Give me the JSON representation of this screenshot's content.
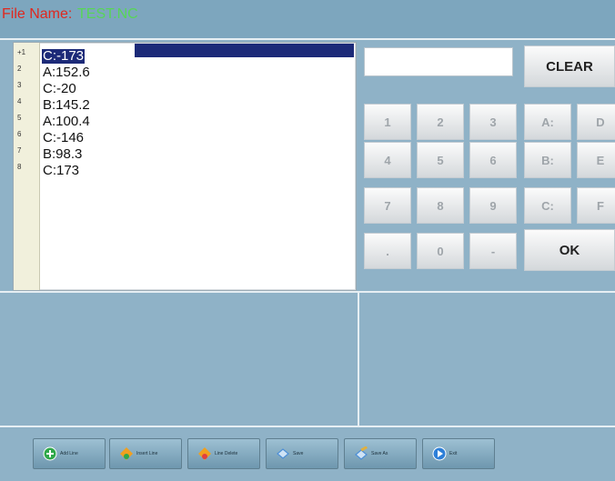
{
  "header": {
    "file_label": "File Name:",
    "file_value": "TEST.NC"
  },
  "editor": {
    "lines": [
      {
        "num": "+1",
        "text": "C:-173"
      },
      {
        "num": "2",
        "text": "A:152.6"
      },
      {
        "num": "3",
        "text": "C:-20"
      },
      {
        "num": "4",
        "text": "B:145.2"
      },
      {
        "num": "5",
        "text": "A:100.4"
      },
      {
        "num": "6",
        "text": "C:-146"
      },
      {
        "num": "7",
        "text": "B:98.3"
      },
      {
        "num": "8",
        "text": "C:173"
      }
    ],
    "selected_line": 1
  },
  "keypad": {
    "display_value": "",
    "clear_label": "CLEAR",
    "ok_label": "OK",
    "rows": [
      [
        "1",
        "2",
        "3",
        "A:",
        "D"
      ],
      [
        "4",
        "5",
        "6",
        "B:",
        "E"
      ],
      [
        "7",
        "8",
        "9",
        "C:",
        "F"
      ],
      [
        ".",
        "0",
        "-"
      ]
    ]
  },
  "toolbar": {
    "buttons": [
      {
        "label": "Add Line",
        "icon": "plus-circle-icon",
        "color": "#2fa84a"
      },
      {
        "label": "Insert Line",
        "icon": "insert-line-icon",
        "color": "#f0a020"
      },
      {
        "label": "Line Delete",
        "icon": "delete-line-icon",
        "color": "#e04040"
      },
      {
        "label": "Save",
        "icon": "save-icon",
        "color": "#4d8fd6"
      },
      {
        "label": "Save As",
        "icon": "save-as-icon",
        "color": "#e0b040"
      },
      {
        "label": "Exit",
        "icon": "exit-icon",
        "color": "#2d7fd8"
      }
    ]
  }
}
